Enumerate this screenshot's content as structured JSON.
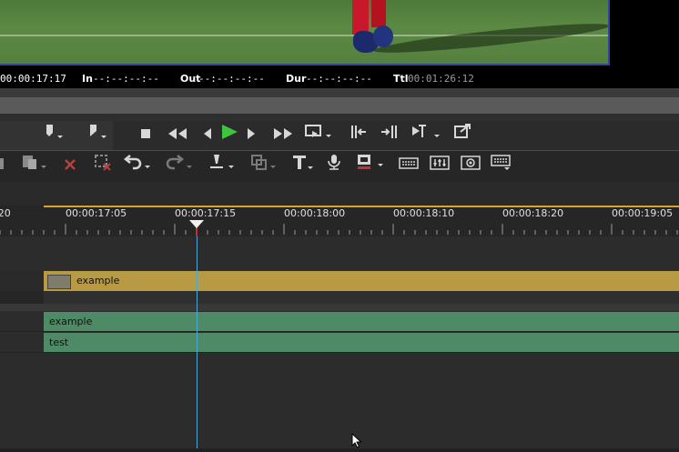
{
  "timecodes": {
    "current": "00:00:17:17",
    "in_label": "In",
    "in_value": "--:--:--:--",
    "out_label": "Out",
    "out_value": "--:--:--:--",
    "dur_label": "Dur",
    "dur_value": "--:--:--:--",
    "ttl_label": "Ttl",
    "ttl_value": "00:01:26:12"
  },
  "ruler": {
    "labels": [
      ":20",
      "00:00:17:05",
      "00:00:17:15",
      "00:00:18:00",
      "00:00:18:10",
      "00:00:18:20",
      "00:00:19:05"
    ]
  },
  "tracks": {
    "video_clip_label": "example",
    "audio1_clip_label": "example",
    "audio2_clip_label": "test"
  },
  "icons": {
    "transport": [
      "mark-in-icon",
      "mark-out-icon",
      "stop-icon",
      "rewind-icon",
      "step-back-icon",
      "play-icon",
      "step-forward-icon",
      "fast-forward-icon",
      "loop-icon",
      "match-in-icon",
      "match-out-icon",
      "trim-icon",
      "export-icon"
    ],
    "toolbar": [
      "copy-icon",
      "paste-icon",
      "delete-icon",
      "ripple-delete-icon",
      "undo-icon",
      "redo-icon",
      "marker-icon",
      "clip-transform-icon",
      "title-icon",
      "voiceover-icon",
      "audio-mixer-icon",
      "keyboard-icon",
      "equalizer-icon",
      "render-icon",
      "shortcuts-icon"
    ]
  },
  "colors": {
    "play": "#3ec43e",
    "video_clip": "#b89a45",
    "audio_clip": "#4f8a66",
    "playhead": "#4fa7d8",
    "ruler_accent": "#e0a030"
  }
}
